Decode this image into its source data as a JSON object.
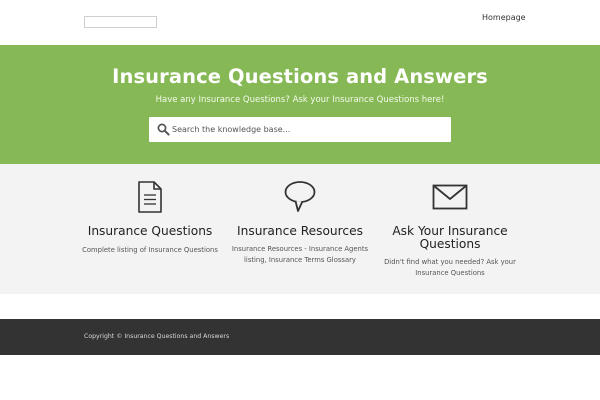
{
  "header": {
    "nav": [
      {
        "label": "Homepage"
      }
    ]
  },
  "hero": {
    "title": "Insurance Questions and Answers",
    "subtitle": "Have any Insurance Questions? Ask your Insurance Questions here!",
    "search_placeholder": "Search the knowledge base...",
    "search_value": ""
  },
  "features": [
    {
      "icon": "document-icon",
      "title": "Insurance Questions",
      "description": "Complete listing of Insurance Questions"
    },
    {
      "icon": "speech-bubble-icon",
      "title": "Insurance Resources",
      "description": "Insurance Resources - Insurance Agents listing, Insurance Terms Glossary"
    },
    {
      "icon": "envelope-icon",
      "title": "Ask Your Insurance Questions",
      "description": "Didn't find what you needed? Ask your Insurance Questions"
    }
  ],
  "footer": {
    "copyright": "Copyright © Insurance Questions and Answers"
  },
  "colors": {
    "hero_bg": "#86b955",
    "features_bg": "#f3f3f3",
    "footer_bg": "#333333"
  }
}
